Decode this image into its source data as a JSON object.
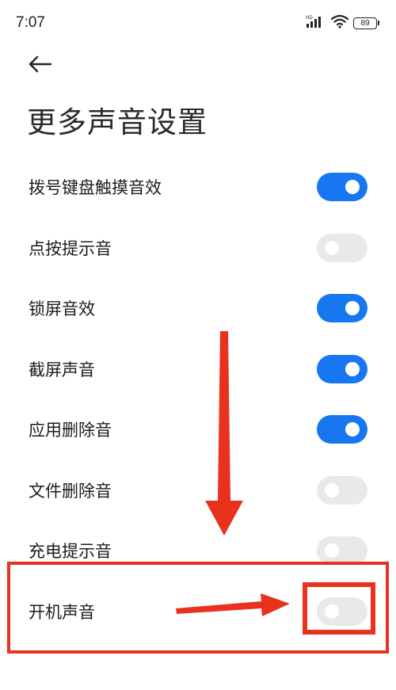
{
  "status_bar": {
    "time": "7:07",
    "network_label": "HD",
    "battery_level": "89"
  },
  "header": {
    "title": "更多声音设置"
  },
  "settings": [
    {
      "label": "拨号键盘触摸音效",
      "on": true
    },
    {
      "label": "点按提示音",
      "on": false
    },
    {
      "label": "锁屏音效",
      "on": true
    },
    {
      "label": "截屏声音",
      "on": true
    },
    {
      "label": "应用删除音",
      "on": true
    },
    {
      "label": "文件删除音",
      "on": false
    },
    {
      "label": "充电提示音",
      "on": false
    },
    {
      "label": "开机声音",
      "on": false
    }
  ],
  "colors": {
    "toggle_on": "#1677f0",
    "toggle_off": "#e9e9e9",
    "annotation": "#e8321e"
  },
  "icons": {
    "back": "arrow-left-icon",
    "signal": "signal-icon",
    "wifi": "wifi-icon",
    "battery": "battery-icon"
  }
}
